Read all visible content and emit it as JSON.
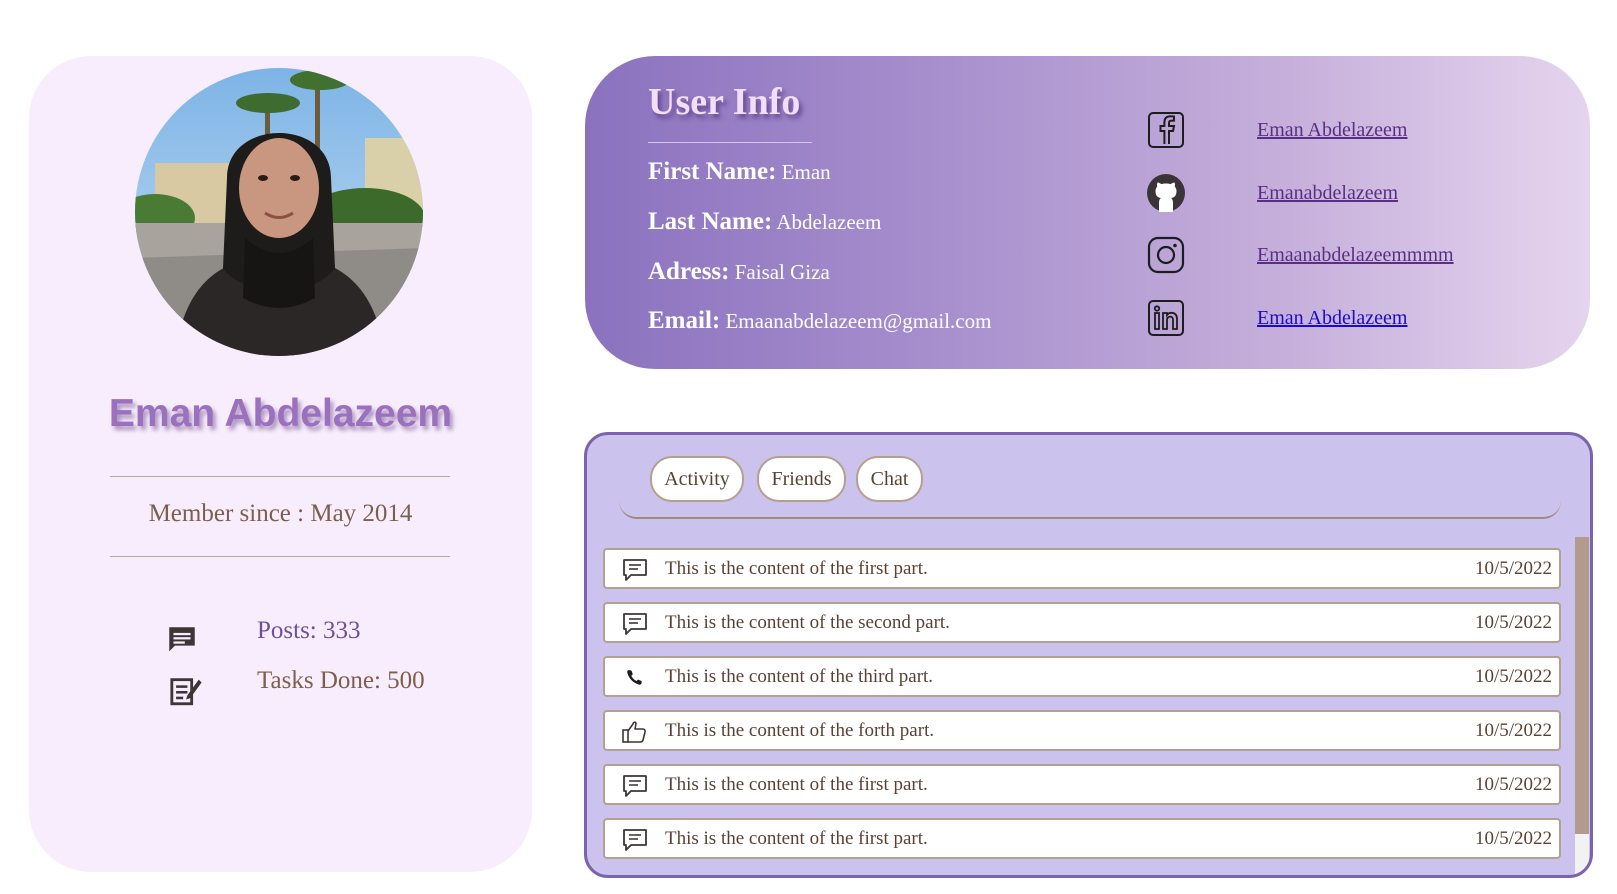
{
  "profile": {
    "name": "Eman Abdelazeem",
    "member_since": "Member since : May 2014",
    "stats": [
      {
        "icon": "comment-icon",
        "label": "Posts: 333"
      },
      {
        "icon": "edit-note-icon",
        "label": "Tasks Done: 500"
      }
    ]
  },
  "user_info": {
    "title": "User Info",
    "fields": [
      {
        "label": "First Name:",
        "value": " Eman"
      },
      {
        "label": "Last Name:",
        "value": " Abdelazeem"
      },
      {
        "label": "Adress:",
        "value": " Faisal Giza"
      },
      {
        "label": "Email:",
        "value": " Emaanabdelazeem@gmail.com"
      }
    ],
    "social": [
      {
        "icon": "facebook-icon",
        "label": "Eman Abdelazeem"
      },
      {
        "icon": "github-icon",
        "label": "Emanabdelazeem"
      },
      {
        "icon": "instagram-icon",
        "label": "Emaanabdelazeemmmm"
      },
      {
        "icon": "linkedin-icon",
        "label": "Eman Abdelazeem"
      }
    ]
  },
  "activity": {
    "tabs": [
      "Activity",
      "Friends",
      "Chat"
    ],
    "items": [
      {
        "icon": "message-icon",
        "text": "This is the content of the first part.",
        "date": "10/5/2022"
      },
      {
        "icon": "message-icon",
        "text": "This is the content of the second part.",
        "date": "10/5/2022"
      },
      {
        "icon": "phone-icon",
        "text": "This is the content of the third part.",
        "date": "10/5/2022"
      },
      {
        "icon": "thumbs-up-icon",
        "text": "This is the content of the forth part.",
        "date": "10/5/2022"
      },
      {
        "icon": "message-icon",
        "text": "This is the content of the first part.",
        "date": "10/5/2022"
      },
      {
        "icon": "message-icon",
        "text": "This is the content of the first part.",
        "date": "10/5/2022"
      }
    ]
  },
  "colors": {
    "profile_bg": "#f7edfc",
    "accent_purple": "#9a70bf",
    "panel_bg": "#cbc2ee",
    "panel_border": "#7b63ad",
    "link_blue": "#1a0ad0"
  }
}
